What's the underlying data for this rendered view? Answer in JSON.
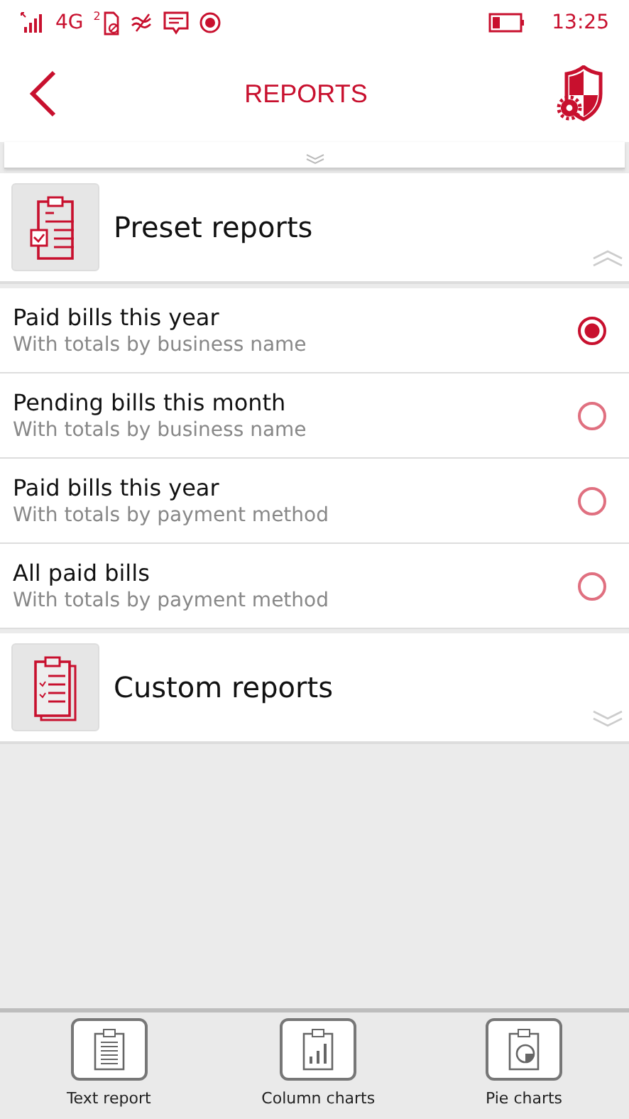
{
  "status_bar": {
    "network": "4G",
    "sim_slot": "2",
    "time": "13:25"
  },
  "header": {
    "title": "REPORTS"
  },
  "sections": [
    {
      "title": "Preset reports",
      "kind": "preset",
      "expanded": true,
      "items": [
        {
          "title": "Paid bills this year",
          "subtitle": "With totals by business name",
          "selected": true
        },
        {
          "title": "Pending bills this month",
          "subtitle": "With totals by business name",
          "selected": false
        },
        {
          "title": "Paid bills this year",
          "subtitle": "With totals by payment method",
          "selected": false
        },
        {
          "title": "All paid bills",
          "subtitle": "With totals by payment method",
          "selected": false
        }
      ]
    },
    {
      "title": "Custom reports",
      "kind": "custom",
      "expanded": false
    }
  ],
  "bottom_bar": [
    {
      "label": "Text report",
      "kind": "text"
    },
    {
      "label": "Column charts",
      "kind": "column"
    },
    {
      "label": "Pie charts",
      "kind": "pie"
    }
  ]
}
